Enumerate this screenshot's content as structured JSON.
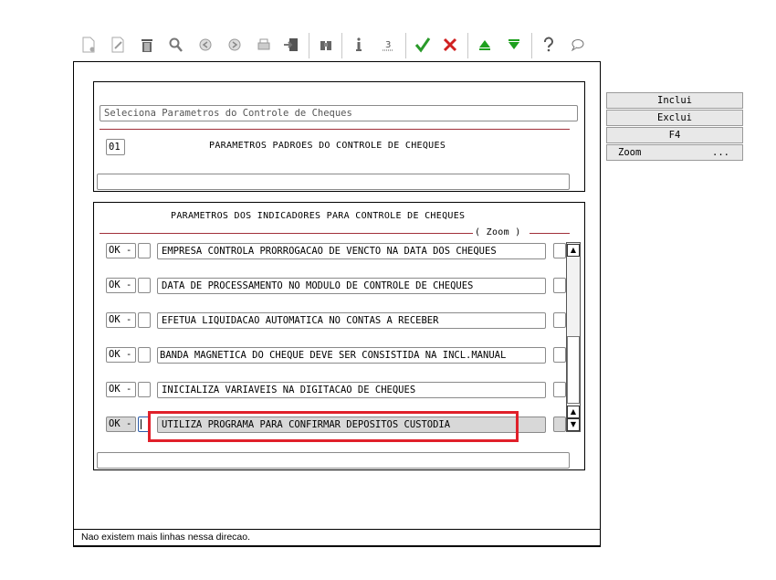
{
  "toolbar": {
    "icons": [
      "new-doc-icon",
      "edit-icon",
      "trash-icon",
      "search-icon",
      "prev-icon",
      "next-icon",
      "print-icon",
      "export-icon",
      "binoculars-icon",
      "info-icon",
      "underline-3-icon",
      "confirm-icon",
      "cancel-icon",
      "arrow-up-icon",
      "arrow-down-icon",
      "help-icon",
      "comment-icon"
    ]
  },
  "header_panel": {
    "title_field": "Seleciona Parametros do Controle de Cheques",
    "code": "01",
    "code_label": "PARAMETROS PADROES DO CONTROLE DE CHEQUES",
    "bottom_field": ""
  },
  "indicators_panel": {
    "title": "PARAMETROS DOS INDICADORES PARA CONTROLE DE CHEQUES",
    "zoom_label": "( Zoom )",
    "rows": [
      {
        "status": "OK -",
        "text": "EMPRESA CONTROLA PRORROGACAO DE VENCTO NA DATA DOS CHEQUES"
      },
      {
        "status": "OK -",
        "text": "DATA DE PROCESSAMENTO NO MODULO DE CONTROLE DE CHEQUES"
      },
      {
        "status": "OK -",
        "text": "EFETUA LIQUIDACAO AUTOMATICA NO CONTAS A RECEBER"
      },
      {
        "status": "OK -",
        "text": "BANDA MAGNETICA DO CHEQUE DEVE SER CONSISTIDA NA INCL.MANUAL"
      },
      {
        "status": "OK -",
        "text": "INICIALIZA VARIAVEIS NA DIGITACAO DE CHEQUES"
      },
      {
        "status": "OK -",
        "text": "UTILIZA PROGRAMA PARA CONFIRMAR DEPOSITOS CUSTODIA"
      }
    ],
    "bottom_field": ""
  },
  "side_buttons": {
    "inclui": "Inclui",
    "exclui": "Exclui",
    "f4": "F4",
    "zoom": "Zoom",
    "zoom_more": "..."
  },
  "status_bar": "Nao existem mais linhas nessa direcao.",
  "colors": {
    "highlight": "#e0202a",
    "divider": "#a0303a",
    "selected_row": "#d8d8d8"
  }
}
